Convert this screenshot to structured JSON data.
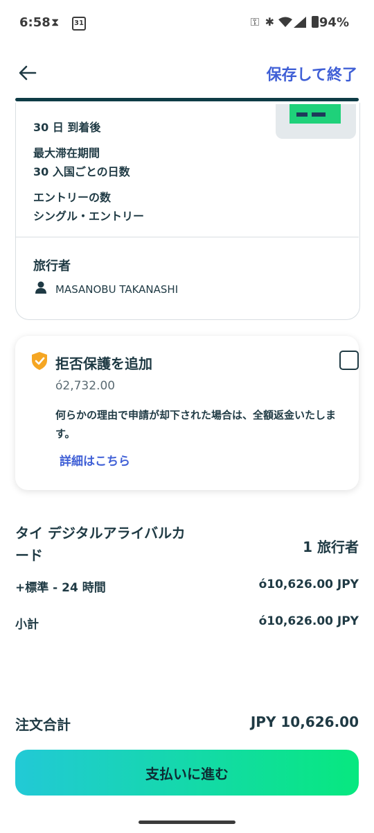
{
  "status_bar": {
    "time": "6:58",
    "battery": "94%",
    "calendar_day": "31"
  },
  "header": {
    "save_exit": "保存して終了"
  },
  "summary": {
    "validity_value": "30 日 到着後",
    "max_stay_label": "最大滞在期間",
    "max_stay_value": "30 入国ごとの日数",
    "entries_label": "エントリーの数",
    "entries_value": "シングル・エントリー",
    "travelers_label": "旅行者",
    "traveler_name": "MASANOBU TAKANASHI"
  },
  "rejection_protection": {
    "title": "拒否保護を追加",
    "price": "ό2,732.00",
    "description": "何らかの理由で申請が却下された場合は、全額返金いたします。",
    "link": "詳細はこちら",
    "checked": false
  },
  "order": {
    "product_name": "タイ デジタルアライバルカード",
    "travelers_count": "1 旅行者",
    "standard_label": "+標準 - 24 時間",
    "standard_price": "ό10,626.00 JPY",
    "subtotal_label": "小計",
    "subtotal_price": "ό10,626.00 JPY",
    "total_label": "注文合計",
    "total_price": "JPY 10,626.00"
  },
  "pay_button": "支払いに進む",
  "colors": {
    "accent_link": "#3f5fd6",
    "text_dark": "#1f3a44",
    "shield_orange": "#f5a623",
    "gradient_start": "#22c9d6",
    "gradient_end": "#07e87f"
  }
}
